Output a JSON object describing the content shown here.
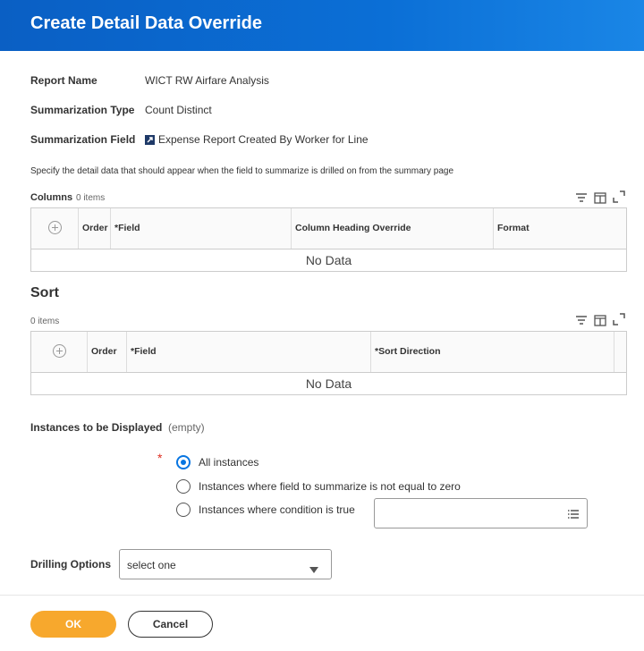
{
  "dialog": {
    "title": "Create Detail Data Override"
  },
  "fields": {
    "report_name": {
      "label": "Report Name",
      "value": "WICT RW Airfare Analysis"
    },
    "summarization_type": {
      "label": "Summarization Type",
      "value": "Count Distinct"
    },
    "summarization_field": {
      "label": "Summarization Field",
      "value": "Expense Report Created By Worker for Line"
    }
  },
  "instructions": "Specify the detail data that should appear when the field to summarize is drilled on from the summary page",
  "columns": {
    "label": "Columns",
    "count": "0 items",
    "headers": [
      "Order",
      "*Field",
      "Column Heading Override",
      "Format"
    ],
    "empty": "No Data"
  },
  "sort": {
    "heading": "Sort",
    "count": "0 items",
    "headers": [
      "Order",
      "*Field",
      "*Sort Direction"
    ],
    "empty": "No Data"
  },
  "instances": {
    "label": "Instances to be Displayed",
    "value": "(empty)",
    "required_mark": "*",
    "options": [
      "All instances",
      "Instances where field to summarize is not equal to zero",
      "Instances where condition is true"
    ],
    "selected_index": 0
  },
  "drilling": {
    "label": "Drilling Options",
    "value": "select one"
  },
  "footer": {
    "ok": "OK",
    "cancel": "Cancel"
  },
  "colors": {
    "brand_blue": "#0b6fd6",
    "ok_orange": "#f7a82d",
    "radio_blue": "#0875e1",
    "required_red": "#de2e21"
  },
  "icons": [
    "field-link-icon",
    "filter-icon",
    "column-chooser-icon",
    "fullscreen-icon",
    "add-row-icon",
    "prompt-list-icon",
    "dropdown-caret-icon"
  ]
}
